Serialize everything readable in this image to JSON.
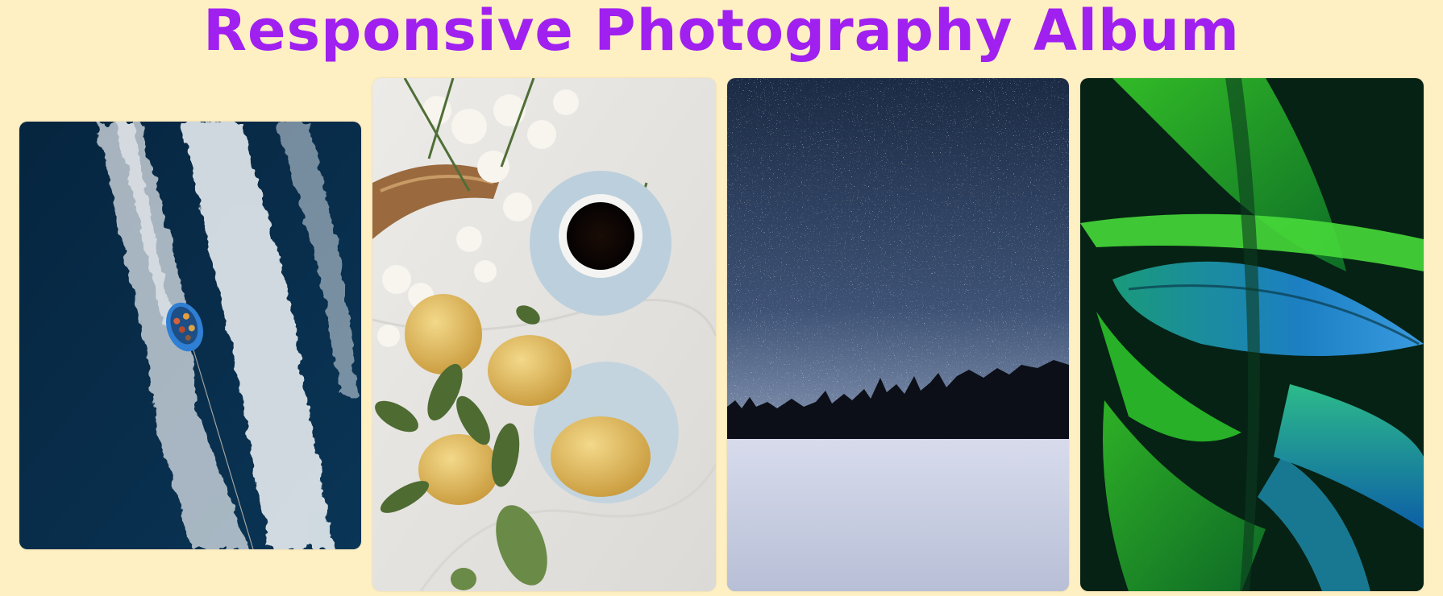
{
  "page": {
    "title": "Responsive Photography Album",
    "background_color": "#fff0c4",
    "title_color": "#a020f0"
  },
  "gallery": {
    "photos": [
      {
        "id": "boat-wake",
        "alt": ""
      },
      {
        "id": "lemons-coffee",
        "alt": ""
      },
      {
        "id": "starry-snow",
        "alt": ""
      },
      {
        "id": "green-leaves",
        "alt": ""
      }
    ]
  }
}
